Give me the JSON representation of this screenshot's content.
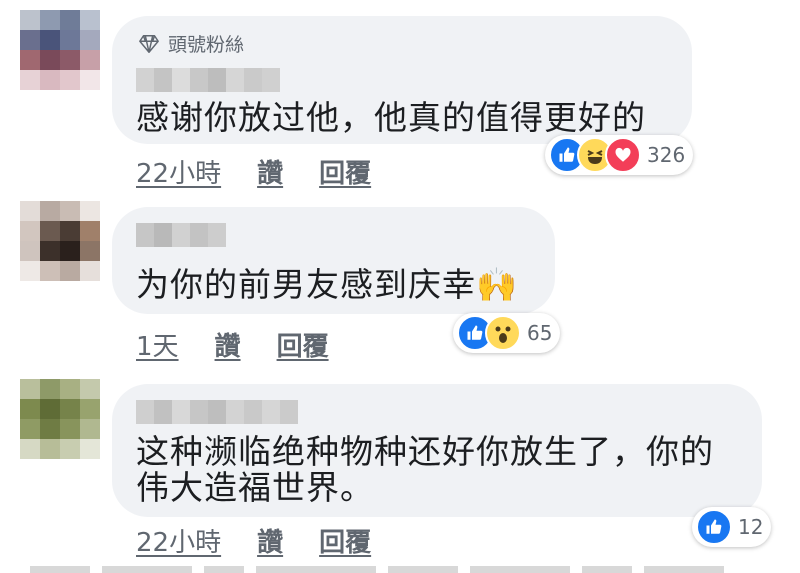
{
  "comments": [
    {
      "badge": "頭號粉絲",
      "text": "感谢你放过他，他真的值得更好的",
      "time": "22小時",
      "like_label": "讚",
      "reply_label": "回覆",
      "reactions": [
        "like-icon",
        "haha-icon",
        "love-icon"
      ],
      "reaction_count": "326"
    },
    {
      "text": "为你的前男友感到庆幸🙌",
      "time": "1天",
      "like_label": "讚",
      "reply_label": "回覆",
      "reactions": [
        "like-icon",
        "wow-icon"
      ],
      "reaction_count": "65"
    },
    {
      "text_line1": "这种濒临绝种物种还好你放生了，你的",
      "text_line2": "伟大造福世界。",
      "time": "22小時",
      "like_label": "讚",
      "reply_label": "回覆",
      "reactions": [
        "like-icon"
      ],
      "reaction_count": "12"
    }
  ],
  "colors": {
    "bubble": "#f0f2f5",
    "meta_text": "#606770",
    "like_blue": "#1877f2",
    "love_red": "#f33e58",
    "haha_yellow": "#ffd95a"
  }
}
